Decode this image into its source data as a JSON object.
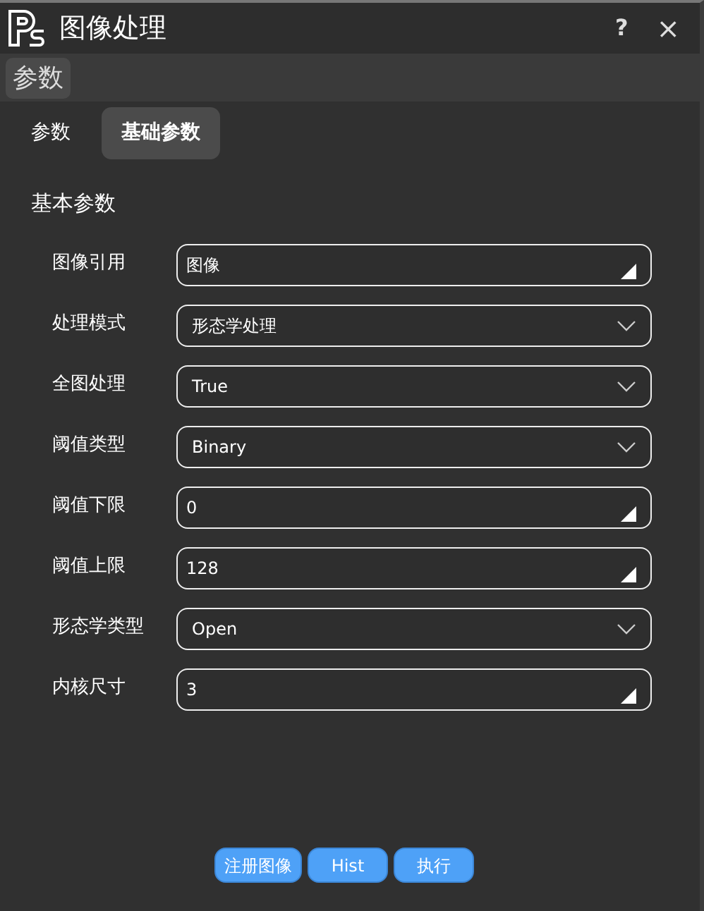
{
  "window": {
    "title": "图像处理",
    "help": "?",
    "close": "×"
  },
  "section_bar": {
    "label": "参数"
  },
  "tabs": [
    {
      "label": "参数",
      "selected": false
    },
    {
      "label": "基础参数",
      "selected": true
    }
  ],
  "group_title": "基本参数",
  "fields": [
    {
      "label": "图像引用",
      "kind": "text",
      "value": "图像"
    },
    {
      "label": "处理模式",
      "kind": "dropdown",
      "value": "形态学处理"
    },
    {
      "label": "全图处理",
      "kind": "dropdown",
      "value": "True"
    },
    {
      "label": "阈值类型",
      "kind": "dropdown",
      "value": "Binary"
    },
    {
      "label": "阈值下限",
      "kind": "text",
      "value": "0"
    },
    {
      "label": "阈值上限",
      "kind": "text",
      "value": "128"
    },
    {
      "label": "形态学类型",
      "kind": "dropdown",
      "value": "Open"
    },
    {
      "label": "内核尺寸",
      "kind": "text",
      "value": "3"
    }
  ],
  "buttons": [
    "注册图像",
    "Hist",
    "执行"
  ]
}
